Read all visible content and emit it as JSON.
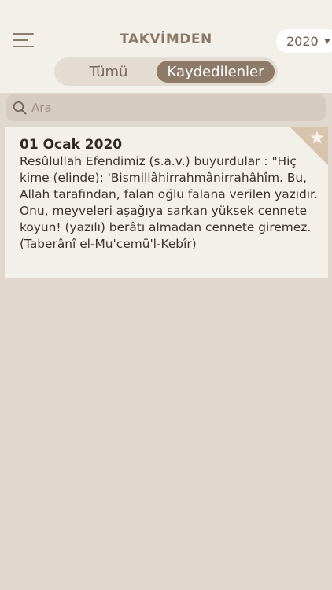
{
  "header": {
    "title": "TAKVİMDEN",
    "year_selected": "2020"
  },
  "segments": {
    "all_label": "Tümü",
    "saved_label": "Kaydedilenler",
    "active": "saved"
  },
  "search": {
    "placeholder": "Ara",
    "value": ""
  },
  "entries": [
    {
      "date": "01 Ocak 2020",
      "text": "Resûlullah Efendimiz (s.a.v.) buyurdular : \"Hiç kime (elinde): 'Bismillâhirrahmânirrahâhîm. Bu, Allah tarafından, falan oğlu falana verilen yazıdır. Onu, meyveleri aşağıya sarkan yüksek cennete koyun! (yazılı) berâtı almadan cennete giremez. (Taberânî el-Mu'cemü'l-Kebîr)",
      "saved": true
    }
  ],
  "colors": {
    "background": "#e0d7ce",
    "header": "#f3efe9",
    "accent": "#8d7a68",
    "corner": "#d8c3ad"
  },
  "icons": {
    "menu": "hamburger-menu-icon",
    "caret": "caret-down-icon",
    "search": "search-icon",
    "star": "star-icon"
  }
}
